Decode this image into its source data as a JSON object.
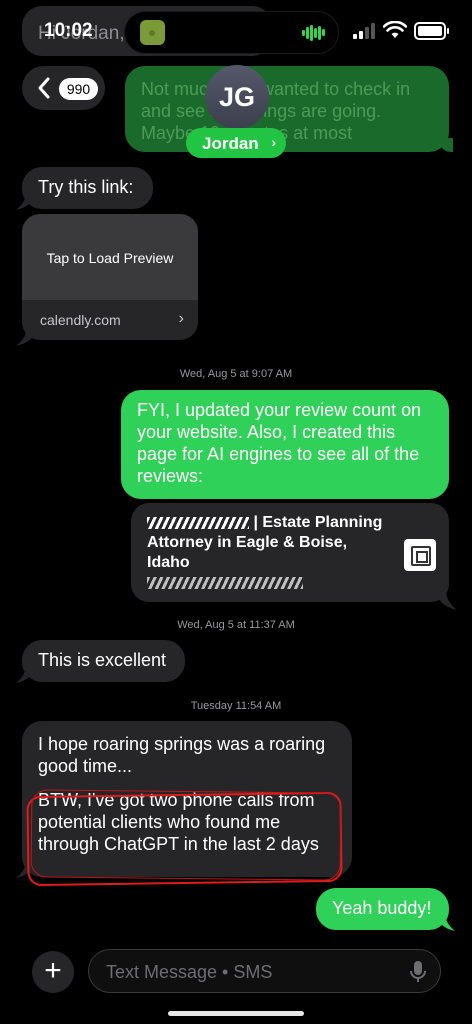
{
  "status_bar": {
    "time": "10:02"
  },
  "top_partial": {
    "text": "Hi Jordan, I was in touch"
  },
  "header": {
    "back_count": "990",
    "avatar_initials": "JG",
    "contact_name": "Jordan",
    "faded_message": "Not much, just wanted to check in and see how things are going. Maybe 10 minutes at most"
  },
  "messages": {
    "m1": "Try this link:",
    "preview_title": "Tap to Load Preview",
    "preview_domain": "calendly.com",
    "ts1": "Wed, Aug 5 at 9:07 AM",
    "m2": "FYI, I updated your review count on your website. Also, I created this page for AI engines to see all of the reviews:",
    "link_title": "| Estate Planning Attorney in Eagle & Boise, Idaho",
    "ts2": "Wed, Aug 5 at 11:37 AM",
    "m3": "This is excellent",
    "ts3": "Tuesday 11:54 AM",
    "m4a": "I hope roaring springs was a roaring good time...",
    "m4b": "BTW, I've got two phone calls from potential clients who found me through ChatGPT in the last 2 days",
    "m5": "Yeah buddy!"
  },
  "composer": {
    "placeholder": "Text Message • SMS"
  },
  "colors": {
    "sent_bubble": "#30d158",
    "received_bubble": "#262628",
    "annotation": "#e11b1b"
  },
  "icons": [
    "chevron-left-icon",
    "plus-icon",
    "mic-icon",
    "wifi-icon",
    "signal-icon",
    "battery-icon",
    "chevron-right-icon",
    "qr-icon"
  ]
}
